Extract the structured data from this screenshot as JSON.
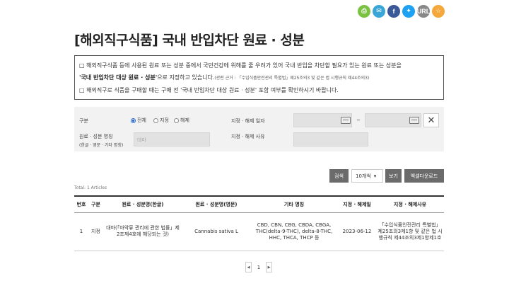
{
  "share": {
    "icons": [
      "print-icon",
      "mail-icon",
      "facebook-icon",
      "twitter-icon",
      "url-copy-icon",
      "favorite-icon"
    ],
    "url_label": "URL"
  },
  "page_title": "[해외직구식품] 국내 반입차단 원료 · 성분",
  "notice": {
    "line1": "□ 해외직구식품 등에 사용된 원료 또는 성분 중에서 국민건강에 위해를 줄 우려가 있어 국내 반입을 차단할 필요가 있는 원료 또는 성분을",
    "line2_bold": "'국내 반입차단 대상 원료 · 성분'",
    "line2_rest": "으로 지정하고 있습니다.",
    "line2_small": "(관련 근거 : 「수입식품안전관리 특별법」제25조의3 및 같은 법 시행규칙 제44조의3)",
    "line3": "□ 해외직구로 식품을 구매할 때는 구매 전 '국내 반입차단 대상 원료 · 성분' 포함 여부를 확인하시기 바랍니다."
  },
  "filter": {
    "type_label": "구분",
    "radio_all": "전체",
    "radio_designated": "지정",
    "radio_released": "해제",
    "selected": "전체",
    "date_label": "지정 · 해제 일자",
    "date_sep": "~",
    "name_label": "원료 · 성분 명칭",
    "name_sub": "(한글 · 영문 · 기타 명칭)",
    "name_placeholder": "대마",
    "reason_label": "지정 · 해제 사유"
  },
  "actions": {
    "search": "검색",
    "page_size": "10개씩",
    "view": "보기",
    "excel": "엑셀다운로드"
  },
  "total": "Total: 1 Articles",
  "table": {
    "headers": [
      "번호",
      "구분",
      "원료 · 성분명(한글)",
      "원료 · 성분명(영문)",
      "기타 명칭",
      "지정 · 해제일",
      "지정 · 해제사유"
    ],
    "rows": [
      {
        "no": "1",
        "type": "지정",
        "name_ko": "대마(「마약류 관리에 관한 법률」제2조제4호에 해당되는 것)",
        "name_en": "Cannabis sativa L",
        "other": "CBD, CBN, CBG, CBDA, CBGA, THC(delta-9-THC), delta-8-THC, HHC, THCA, THCP 등",
        "date": "2023-06-12",
        "reason": "「수입식품안전관리 특별법」제25조의3제1항 및 같은 법 시행규칙 제44조의3제1항제1호"
      }
    ]
  },
  "pager": {
    "prev": "◀",
    "current": "1",
    "next": "▶"
  }
}
